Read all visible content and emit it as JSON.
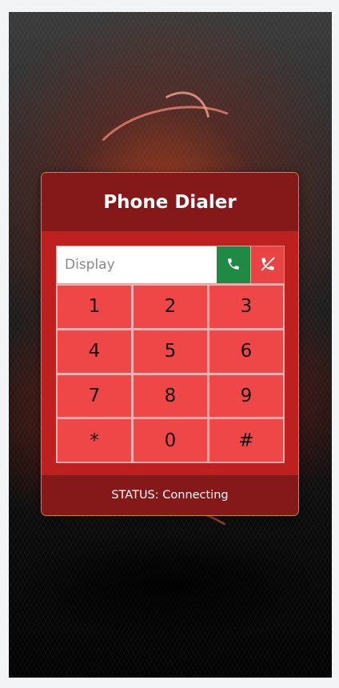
{
  "dialer": {
    "title": "Phone Dialer",
    "display": {
      "value": "",
      "placeholder": "Display"
    },
    "call_icon": "phone-icon",
    "hangup_icon": "phone-hangup-icon",
    "keys": [
      "1",
      "2",
      "3",
      "4",
      "5",
      "6",
      "7",
      "8",
      "9",
      "*",
      "0",
      "#"
    ],
    "status": "STATUS: Connecting"
  },
  "colors": {
    "card": "#be1f1f",
    "header": "#85191a",
    "key": "#ef4747",
    "call": "#1e8a43",
    "hangup": "#e94444"
  }
}
